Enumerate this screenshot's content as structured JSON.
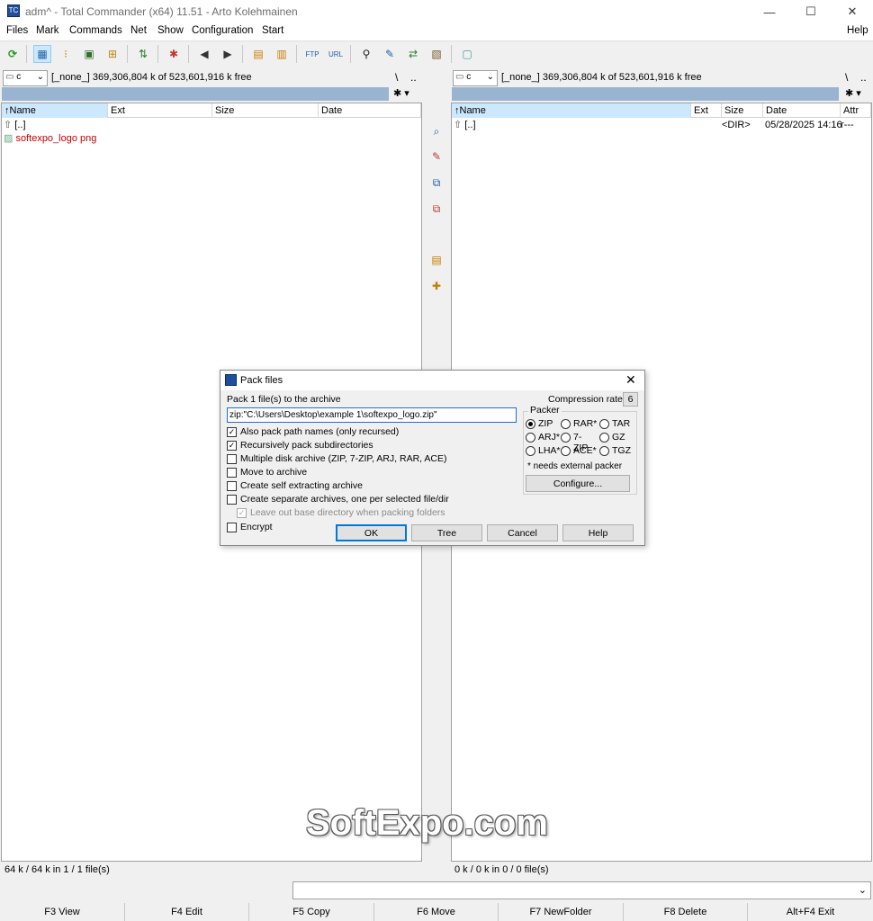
{
  "window": {
    "title": "adm^ - Total Commander (x64) 11.51 - Arto Kolehmainen",
    "minimize": "—",
    "maximize": "☐",
    "close": "✕"
  },
  "menu": [
    "Files",
    "Mark",
    "Commands",
    "Net",
    "Show",
    "Configuration",
    "Start",
    "Help"
  ],
  "left_panel": {
    "drive": "c",
    "free_info": "[_none_]  369,306,804 k of 523,601,916 k free",
    "root_btn": "\\",
    "up_btn": "..",
    "filter_icon": "✱ ▾",
    "columns": [
      "Name",
      "Ext",
      "Size",
      "Date"
    ],
    "rows": [
      {
        "name": "[..]",
        "ext": "",
        "size": "",
        "date": ""
      },
      {
        "name": "softexpo_logo png",
        "ext": "",
        "size": "",
        "date": ""
      }
    ],
    "status": "64 k / 64 k in 1 / 1 file(s)"
  },
  "right_panel": {
    "drive": "c",
    "free_info": "[_none_]  369,306,804 k of 523,601,916 k free",
    "root_btn": "\\",
    "up_btn": "..",
    "filter_icon": "✱ ▾",
    "columns": [
      "Name",
      "Ext",
      "Size",
      "Date",
      "Attr"
    ],
    "rows": [
      {
        "name": "[..]",
        "ext": "",
        "size": "<DIR>",
        "date": "05/28/2025 14:16",
        "attr": "r---"
      }
    ],
    "status": "0 k / 0 k in 0 / 0 file(s)"
  },
  "dialog": {
    "title": "Pack files",
    "pack_label": "Pack  1 file(s) to the archive",
    "compression_label": "Compression rate:",
    "compression_value": "6",
    "target_value": "zip:\"C:\\Users\\Desktop\\example 1\\softexpo_logo.zip\"",
    "options": [
      {
        "label": "Also pack path names (only recursed)",
        "checked": true
      },
      {
        "label": "Recursively pack subdirectories",
        "checked": true
      },
      {
        "label": "Multiple disk archive (ZIP, 7-ZIP, ARJ, RAR, ACE)",
        "checked": false
      },
      {
        "label": "Move to archive",
        "checked": false
      },
      {
        "label": "Create self extracting archive",
        "checked": false
      },
      {
        "label": "Create separate archives, one per selected file/dir",
        "checked": false
      },
      {
        "label": "Leave out base directory when packing folders",
        "checked": true,
        "disabled": true
      },
      {
        "label": "Encrypt",
        "checked": false
      }
    ],
    "packer_label": "Packer",
    "packers": [
      "ZIP",
      "RAR*",
      "TAR",
      "ARJ*",
      "7-ZIP",
      "GZ",
      "LHA*",
      "ACE*",
      "TGZ"
    ],
    "packer_selected": "ZIP",
    "packer_note": "* needs external packer",
    "configure": "Configure...",
    "ok": "OK",
    "tree": "Tree",
    "cancel": "Cancel",
    "help": "Help"
  },
  "function_keys": [
    "F3 View",
    "F4 Edit",
    "F5 Copy",
    "F6 Move",
    "F7 NewFolder",
    "F8 Delete",
    "Alt+F4 Exit"
  ],
  "watermark": "SoftExpo.com",
  "colors": {
    "accent_selection": "#99b4d1",
    "file_red": "#c00000",
    "header_selected": "#cce8ff"
  }
}
